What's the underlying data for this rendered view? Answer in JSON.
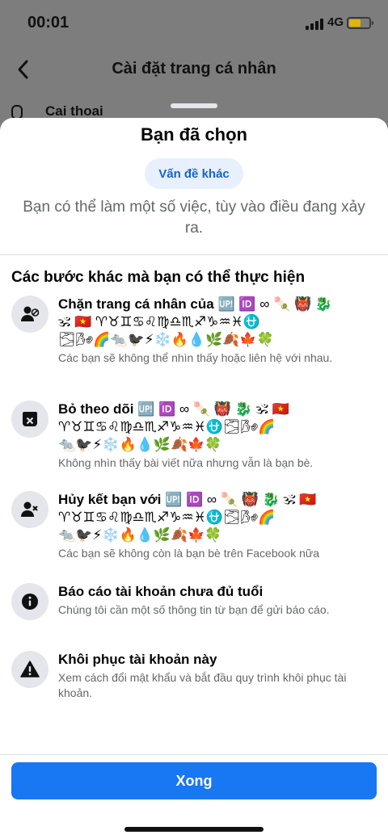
{
  "status_bar": {
    "time": "00:01",
    "network": "4G"
  },
  "background": {
    "title": "Cài đặt trang cá nhân",
    "row_label": "Cai thoai"
  },
  "sheet": {
    "title": "Bạn đã chọn",
    "selected_pill": "Vấn đề khác",
    "intro": "Bạn có thể làm một số việc, tùy vào điều đang xảy ra.",
    "section_title": "Các bước khác mà bạn có thể thực hiện",
    "options": [
      {
        "icon": "person-block-icon",
        "title": "Chặn trang cá nhân của",
        "emoji_inline": "🆙 🆔 ∞ 🍡 👹 🐉",
        "emoji_line2": "🕉 🇻🇳 ♈♉♊♋♌♍♎♏♐♑♒♓⛎",
        "emoji_line3": "🌫🌬🌈🐀🐦‍⬛⚡❄️🔥💧🌿🍂🍁🍀",
        "description": "Các bạn sẽ không thể nhìn thấy hoặc liên hệ với nhau."
      },
      {
        "icon": "unfollow-box-icon",
        "title": "Bỏ theo dõi",
        "emoji_inline": "🆙 🆔 ∞ 🍡 👹 🐉 🕉 🇻🇳",
        "emoji_line2": "♈♉♊♋♌♍♎♏♐♑♒♓⛎🌫🌬🌈",
        "emoji_line3": "🐀🐦‍⬛⚡❄️🔥💧🌿🍂🍁🍀",
        "description": "Không nhìn thấy bài viết nữa nhưng vẫn là bạn bè."
      },
      {
        "icon": "person-remove-icon",
        "title": "Hủy kết bạn với",
        "emoji_inline": "🆙 🆔 ∞ 🍡 👹 🐉 🕉 🇻🇳",
        "emoji_line2": "♈♉♊♋♌♍♎♏♐♑♒♓⛎🌫🌬🌈",
        "emoji_line3": "🐀🐦‍⬛⚡❄️🔥💧🌿🍂🍁🍀",
        "description": "Các bạn sẽ không còn là bạn bè trên Facebook nữa"
      },
      {
        "icon": "info-icon",
        "title": "Báo cáo tài khoản chưa đủ tuổi",
        "description": "Chúng tôi cần một số thông tin từ bạn để gửi báo cáo."
      },
      {
        "icon": "warning-icon",
        "title": "Khôi phục tài khoản này",
        "description": "Xem cách đổi mật khẩu và bắt đầu quy trình khôi phục tài khoản."
      }
    ],
    "done_label": "Xong"
  }
}
